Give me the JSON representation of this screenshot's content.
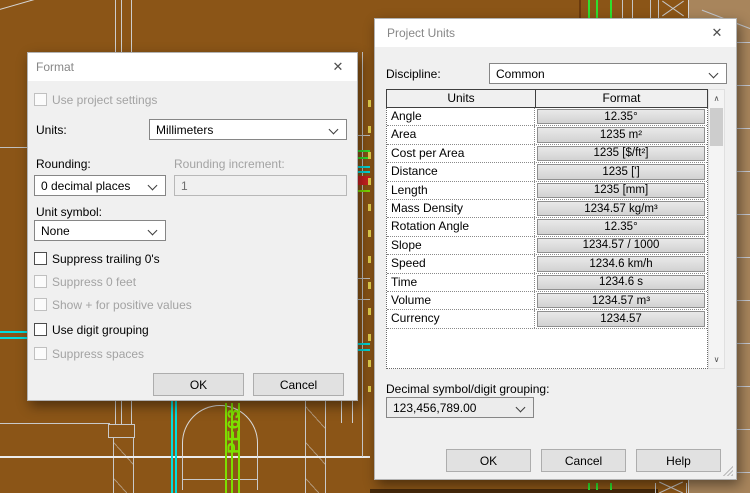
{
  "canvas": {
    "pipe_label": "PE63",
    "colors": {
      "background": "#8b5517",
      "stairs_area": "#a8855c",
      "wall_line": "#cccccc",
      "pipe_cyan": "#00dede",
      "pipe_green": "#7de000",
      "accent_green": "#2ee02e",
      "accent_red": "#cf2222",
      "accent_yellow": "#e8d44d"
    }
  },
  "icons": {
    "close": "✕",
    "scroll_up": "∧",
    "scroll_down": "∨"
  },
  "format_dialog": {
    "title": "Format",
    "use_project_settings_label": "Use project settings",
    "units_label": "Units:",
    "units_value": "Millimeters",
    "rounding_label": "Rounding:",
    "rounding_value": "0 decimal places",
    "rounding_increment_label": "Rounding increment:",
    "rounding_increment_value": "1",
    "unit_symbol_label": "Unit symbol:",
    "unit_symbol_value": "None",
    "checkboxes": [
      {
        "label": "Suppress trailing 0's",
        "enabled": true,
        "checked": false
      },
      {
        "label": "Suppress 0 feet",
        "enabled": false,
        "checked": false
      },
      {
        "label": "Show + for positive values",
        "enabled": false,
        "checked": false
      },
      {
        "label": "Use digit grouping",
        "enabled": true,
        "checked": false
      },
      {
        "label": "Suppress spaces",
        "enabled": false,
        "checked": false
      }
    ],
    "ok_label": "OK",
    "cancel_label": "Cancel"
  },
  "project_units_dialog": {
    "title": "Project Units",
    "discipline_label": "Discipline:",
    "discipline_value": "Common",
    "table": {
      "headers": [
        "Units",
        "Format"
      ],
      "rows": [
        {
          "unit": "Angle",
          "format": "12.35°"
        },
        {
          "unit": "Area",
          "format": "1235 m²"
        },
        {
          "unit": "Cost per Area",
          "format": "1235 [$/ft²]"
        },
        {
          "unit": "Distance",
          "format": "1235 [']"
        },
        {
          "unit": "Length",
          "format": "1235 [mm]"
        },
        {
          "unit": "Mass Density",
          "format": "1234.57 kg/m³"
        },
        {
          "unit": "Rotation Angle",
          "format": "12.35°"
        },
        {
          "unit": "Slope",
          "format": "1234.57 / 1000"
        },
        {
          "unit": "Speed",
          "format": "1234.6 km/h"
        },
        {
          "unit": "Time",
          "format": "1234.6 s"
        },
        {
          "unit": "Volume",
          "format": "1234.57 m³"
        },
        {
          "unit": "Currency",
          "format": "1234.57"
        }
      ]
    },
    "decimal_grouping_label": "Decimal symbol/digit grouping:",
    "decimal_grouping_value": "123,456,789.00",
    "ok_label": "OK",
    "cancel_label": "Cancel",
    "help_label": "Help"
  }
}
